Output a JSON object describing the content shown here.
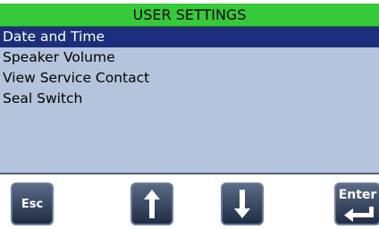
{
  "header": {
    "title": "USER SETTINGS"
  },
  "menu": {
    "items": [
      {
        "label": "Date and Time",
        "selected": true
      },
      {
        "label": "Speaker Volume",
        "selected": false
      },
      {
        "label": "View Service Contact",
        "selected": false
      },
      {
        "label": "Seal Switch",
        "selected": false
      }
    ]
  },
  "softkeys": {
    "esc": {
      "label": "Esc"
    },
    "up": {
      "icon": "arrow-up-icon"
    },
    "down": {
      "icon": "arrow-down-icon"
    },
    "enter": {
      "label": "Enter",
      "icon": "enter-return-icon"
    }
  },
  "colors": {
    "title_bar": "#36c93a",
    "menu_background": "#b4c4dc",
    "selected_item": "#1d2f7c",
    "softkey": "#2f3d5a"
  }
}
